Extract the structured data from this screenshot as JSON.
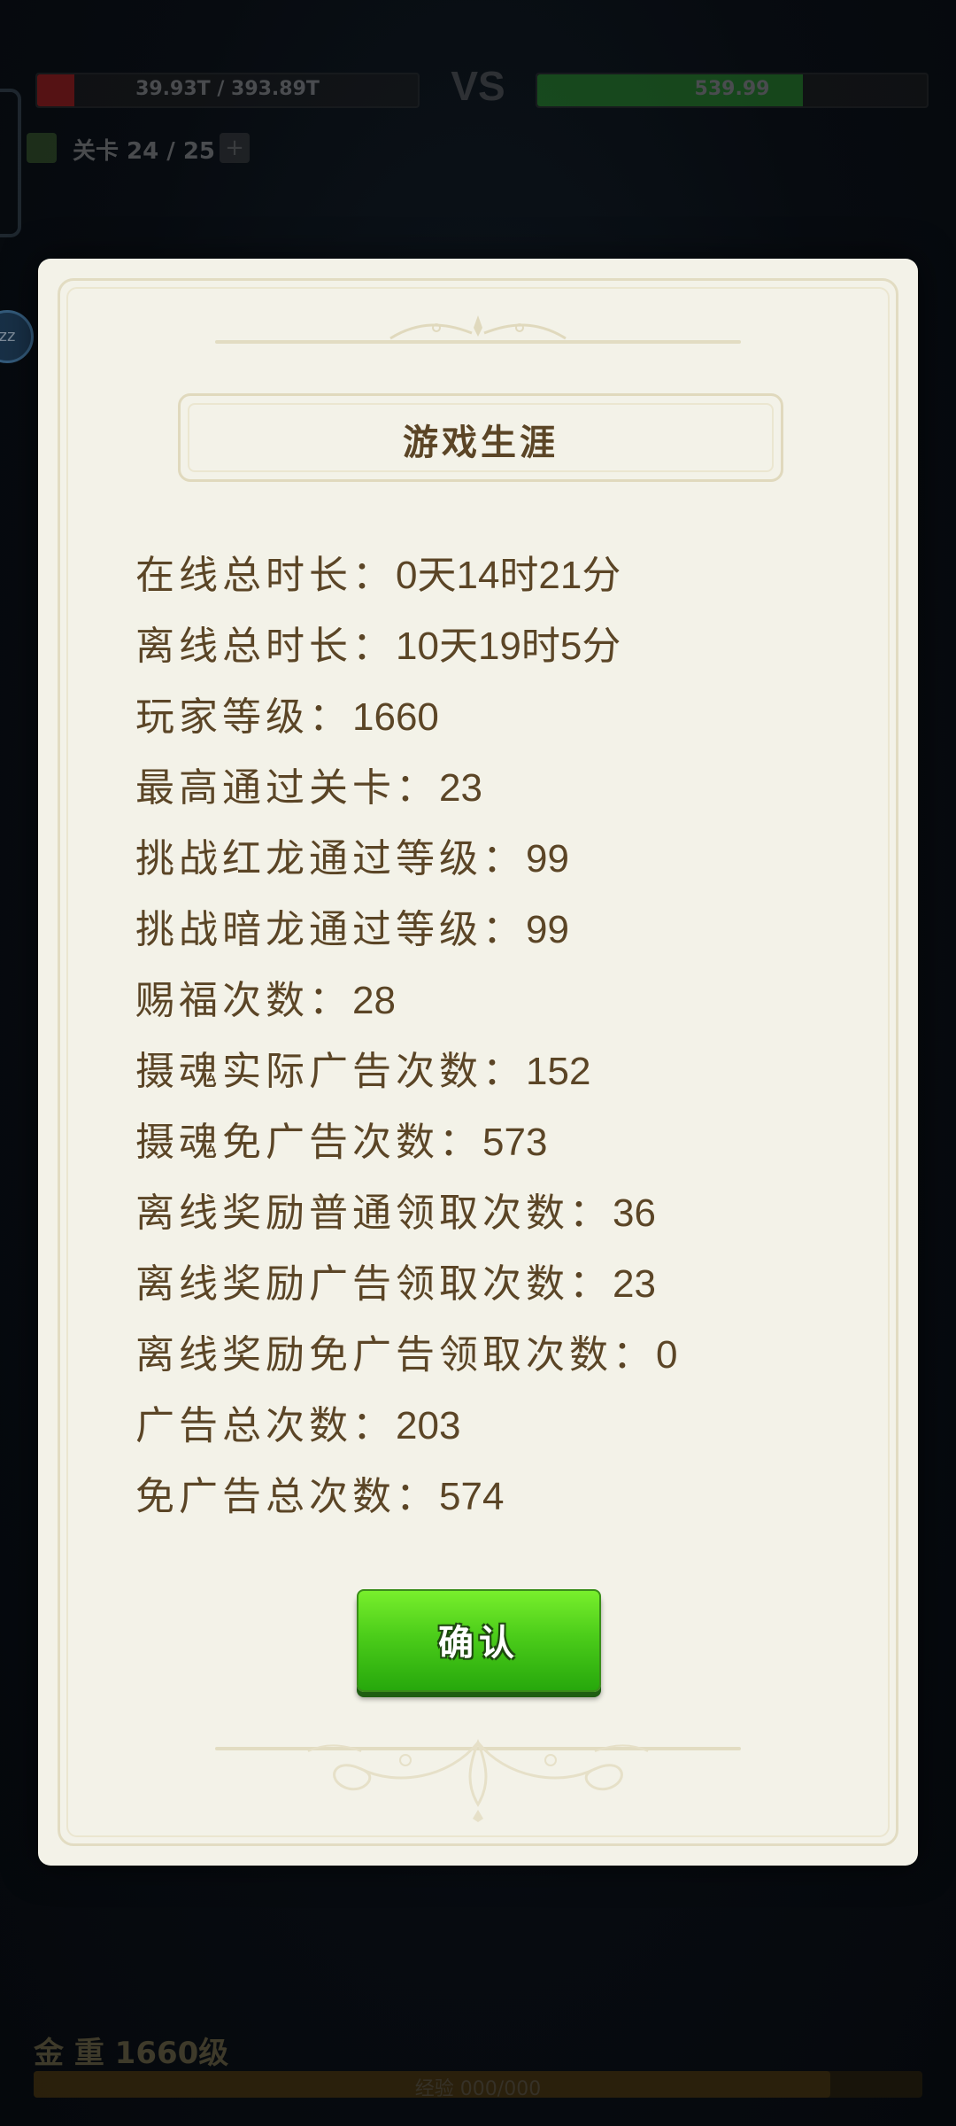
{
  "hud": {
    "player_hp": "39.93T / 393.89T",
    "vs_label": "VS",
    "enemy_hp": "539.99",
    "stage_label": "关卡 24 / 25",
    "stage_plus": "+",
    "zz_badge": "zz",
    "bottom_title": "金 重 1660级",
    "exp_text": "经验 000/000"
  },
  "modal": {
    "title": "游戏生涯",
    "stats": [
      {
        "label": "在线总时长：",
        "value": "0天14时21分"
      },
      {
        "label": "离线总时长：",
        "value": "10天19时5分"
      },
      {
        "label": "玩家等级：",
        "value": "1660"
      },
      {
        "label": "最高通过关卡：",
        "value": "23"
      },
      {
        "label": "挑战红龙通过等级：",
        "value": "99"
      },
      {
        "label": "挑战暗龙通过等级：",
        "value": "99"
      },
      {
        "label": "赐福次数：",
        "value": "28"
      },
      {
        "label": "摄魂实际广告次数：",
        "value": "152"
      },
      {
        "label": "摄魂免广告次数：",
        "value": "573"
      },
      {
        "label": "离线奖励普通领取次数：",
        "value": "36"
      },
      {
        "label": "离线奖励广告领取次数：",
        "value": "23"
      },
      {
        "label": "离线奖励免广告领取次数：",
        "value": "0"
      },
      {
        "label": "广告总次数：",
        "value": "203"
      },
      {
        "label": "免广告总次数：",
        "value": "574"
      }
    ],
    "confirm_label": "确认"
  },
  "colors": {
    "modal_bg": "#f3f2e8",
    "text_brown": "#5b4526",
    "button_green": "#4ccd1a"
  }
}
